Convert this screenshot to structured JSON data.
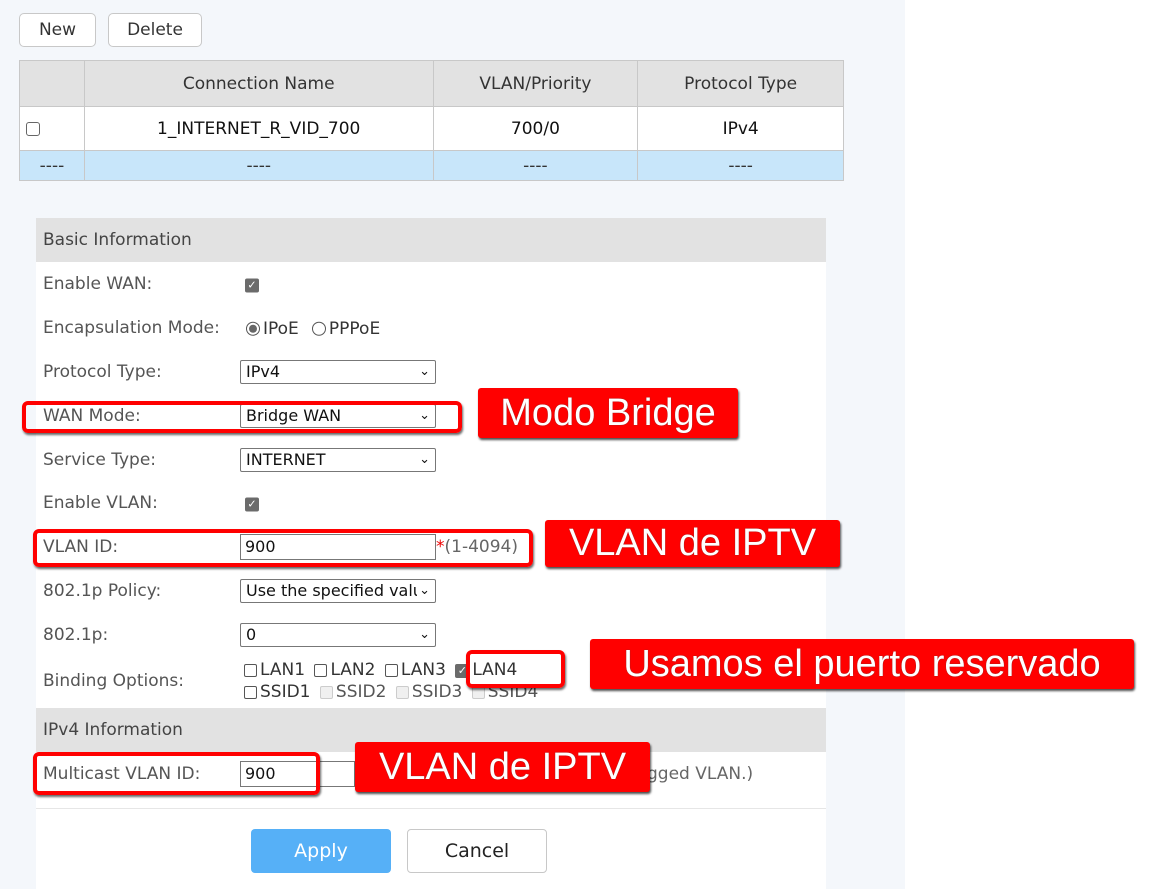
{
  "toolbar": {
    "new_label": "New",
    "delete_label": "Delete"
  },
  "connections_table": {
    "headers": [
      "",
      "Connection Name",
      "VLAN/Priority",
      "Protocol Type"
    ],
    "rows": [
      {
        "selected": false,
        "name": "1_INTERNET_R_VID_700",
        "vlan_priority": "700/0",
        "protocol": "IPv4"
      }
    ],
    "new_row": {
      "c0": "----",
      "c1": "----",
      "c2": "----",
      "c3": "----"
    }
  },
  "basic_info": {
    "title": "Basic Information",
    "enable_wan": {
      "label": "Enable WAN:",
      "checked": true
    },
    "encapsulation": {
      "label": "Encapsulation Mode:",
      "options": [
        "IPoE",
        "PPPoE"
      ],
      "selected": "IPoE"
    },
    "protocol_type": {
      "label": "Protocol Type:",
      "value": "IPv4"
    },
    "wan_mode": {
      "label": "WAN Mode:",
      "value": "Bridge WAN"
    },
    "service_type": {
      "label": "Service Type:",
      "value": "INTERNET"
    },
    "enable_vlan": {
      "label": "Enable VLAN:",
      "checked": true
    },
    "vlan_id": {
      "label": "VLAN ID:",
      "value": "900",
      "required_mark": "*",
      "range_hint": "(1-4094)"
    },
    "policy_8021p": {
      "label": "802.1p Policy:",
      "value": "Use the specified valu"
    },
    "value_8021p": {
      "label": "802.1p:",
      "value": "0"
    },
    "binding": {
      "label": "Binding Options:",
      "options": [
        {
          "label": "LAN1",
          "checked": false,
          "enabled": true
        },
        {
          "label": "LAN2",
          "checked": false,
          "enabled": true
        },
        {
          "label": "LAN3",
          "checked": false,
          "enabled": true
        },
        {
          "label": "LAN4",
          "checked": true,
          "enabled": true
        },
        {
          "label": "SSID1",
          "checked": false,
          "enabled": true
        },
        {
          "label": "SSID2",
          "checked": false,
          "enabled": false
        },
        {
          "label": "SSID3",
          "checked": false,
          "enabled": false
        },
        {
          "label": "SSID4",
          "checked": false,
          "enabled": false
        }
      ]
    }
  },
  "ipv4_info": {
    "title": "IPv4 Information",
    "multicast_vlan": {
      "label": "Multicast VLAN ID:",
      "value": "900",
      "hint_visible": "gged VLAN.)"
    }
  },
  "actions": {
    "apply_label": "Apply",
    "cancel_label": "Cancel"
  },
  "annotations": {
    "wan_mode_note": "Modo Bridge",
    "vlan_id_note": "VLAN de IPTV",
    "lan4_note": "Usamos el puerto reservado",
    "multicast_note": "VLAN de IPTV",
    "color": "#ff0000"
  },
  "colors": {
    "apply_button": "#56b0f7",
    "table_header": "#e2e2e2",
    "new_row_highlight": "#c8e6fa",
    "page_background": "#f4f7fb"
  }
}
